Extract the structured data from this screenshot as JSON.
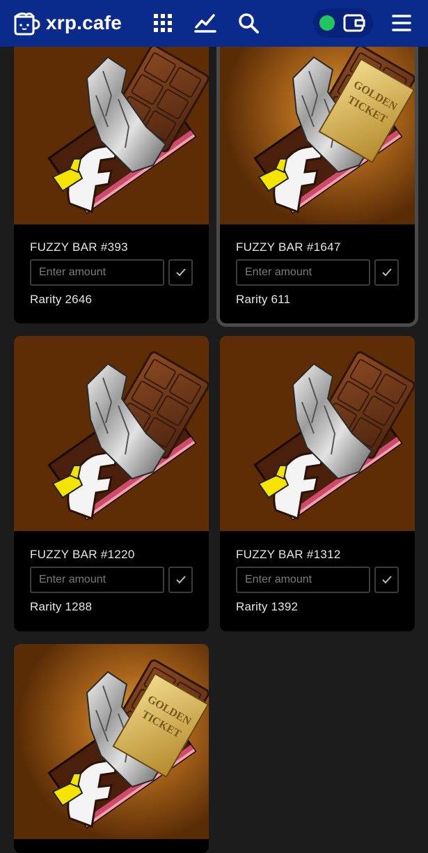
{
  "header": {
    "brand": "xrp.cafe",
    "colors": {
      "bar": "#0a2a8c",
      "wallet_connected": "#22c55e"
    },
    "icons": [
      "cafe-cup-icon",
      "grid-menu-icon",
      "chart-icon",
      "search-icon",
      "wallet-icon",
      "hamburger-menu-icon"
    ]
  },
  "cards": [
    {
      "title": "FUZZY BAR #393",
      "placeholder": "Enter amount",
      "rarity": "Rarity 2646",
      "golden_ticket": false,
      "selected": false
    },
    {
      "title": "FUZZY BAR #1647",
      "placeholder": "Enter amount",
      "rarity": "Rarity 611",
      "golden_ticket": true,
      "selected": true
    },
    {
      "title": "FUZZY BAR #1220",
      "placeholder": "Enter amount",
      "rarity": "Rarity 1288",
      "golden_ticket": false,
      "selected": false
    },
    {
      "title": "FUZZY BAR #1312",
      "placeholder": "Enter amount",
      "rarity": "Rarity 1392",
      "golden_ticket": false,
      "selected": false
    },
    {
      "title": "",
      "placeholder": "",
      "rarity": "",
      "golden_ticket": true,
      "selected": false
    }
  ]
}
